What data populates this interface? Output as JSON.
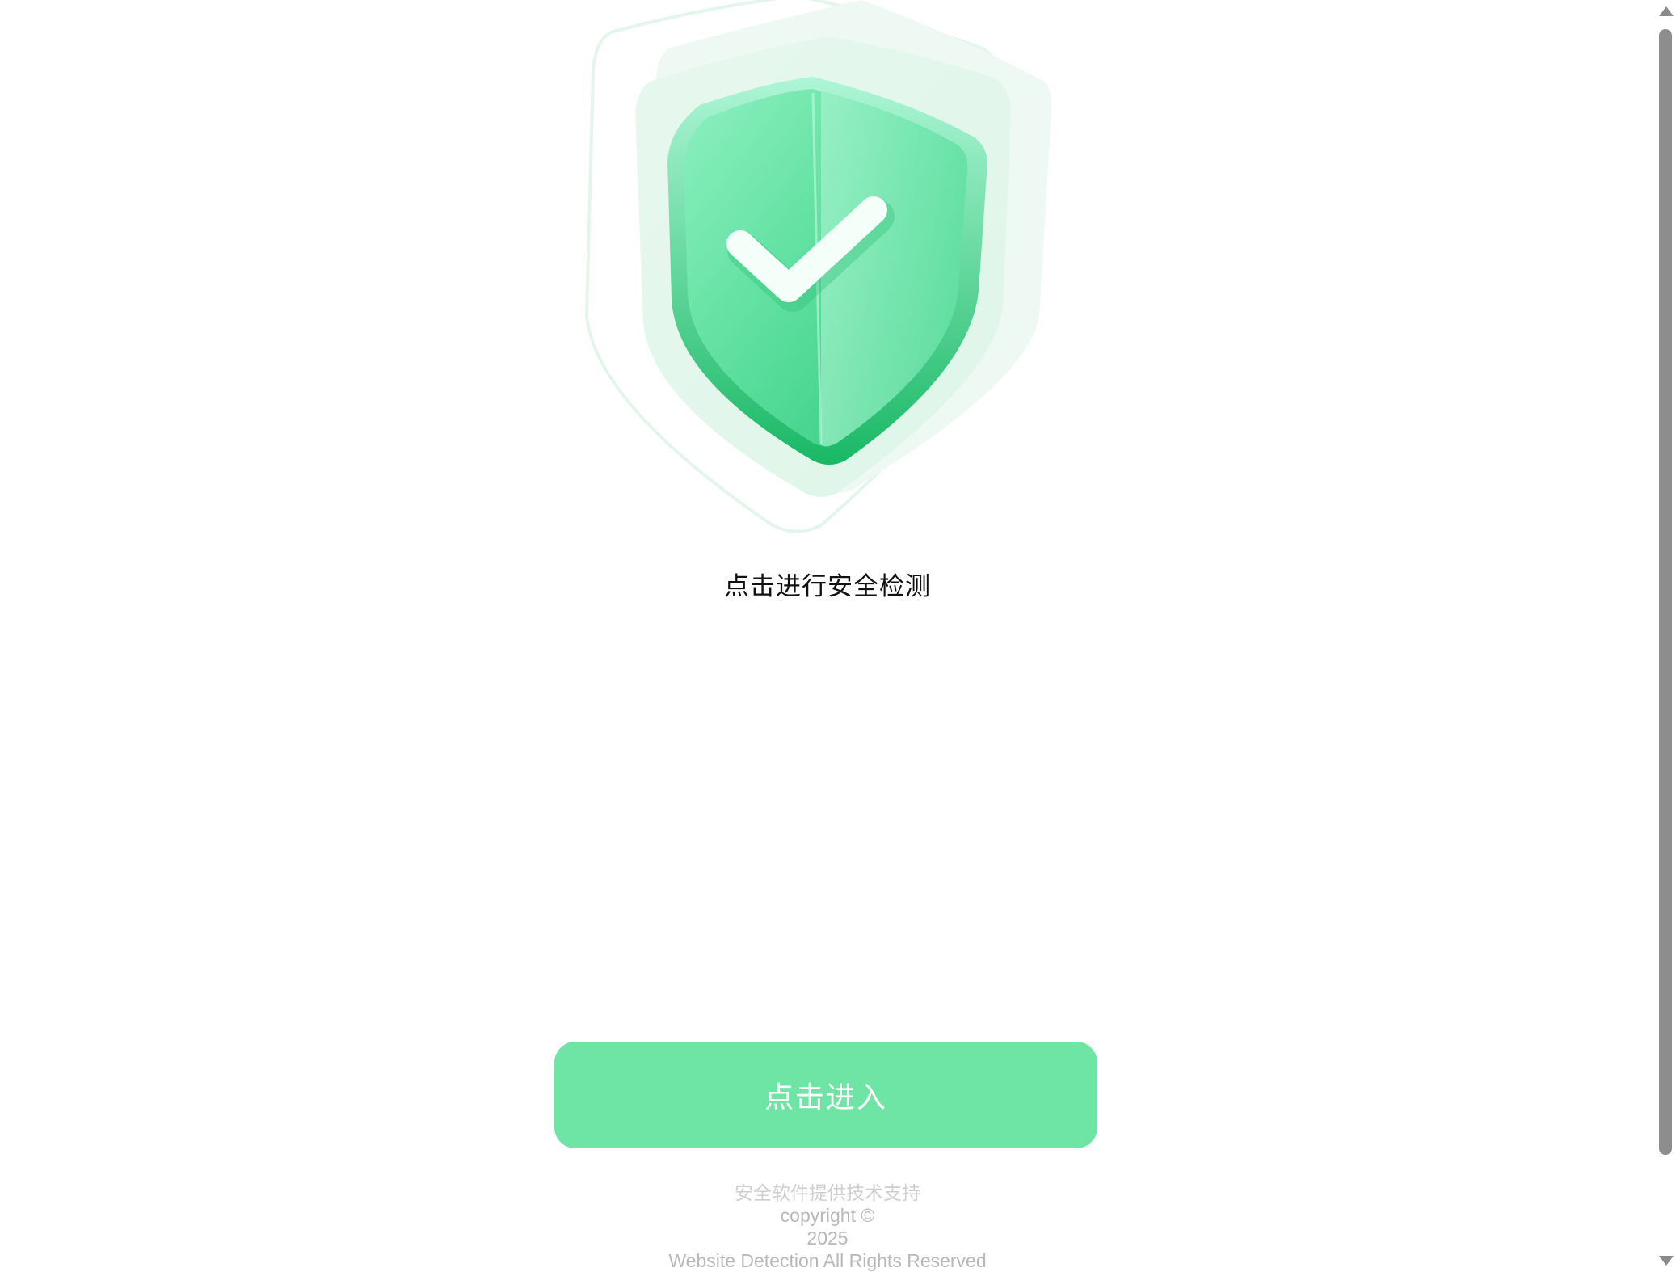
{
  "main": {
    "headline": "点击进行安全检测",
    "enter_button_label": "点击进入"
  },
  "footer": {
    "support": "安全软件提供技术支持",
    "copyright": "copyright ©",
    "year": "2025",
    "rights": "Website Detection All Rights Reserved"
  },
  "icons": {
    "hero": "shield-check-icon"
  },
  "colors": {
    "accent": "#6ee4a5",
    "shield_dark": "#2fc97a",
    "shield_light": "#b8f5d8"
  }
}
